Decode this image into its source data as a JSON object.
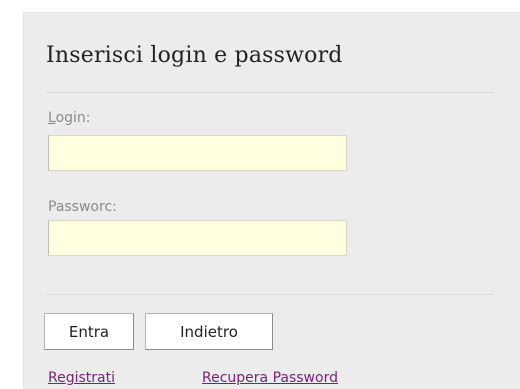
{
  "form": {
    "title": "Inserisci login e password",
    "login": {
      "label_accesskey": "L",
      "label_rest": "ogin:",
      "value": "",
      "placeholder": ""
    },
    "password": {
      "label": "Passworc:",
      "value": "",
      "placeholder": ""
    },
    "buttons": {
      "submit_label": "Entra",
      "back_label": "Indietro"
    },
    "links": {
      "register_label": "Registrati",
      "recover_label": "Recupera Password"
    }
  },
  "colors": {
    "panel_background": "#ececec",
    "input_background": "#ffffe0",
    "link_visited": "#7a1f7a",
    "label_text": "#8a8a8a"
  }
}
